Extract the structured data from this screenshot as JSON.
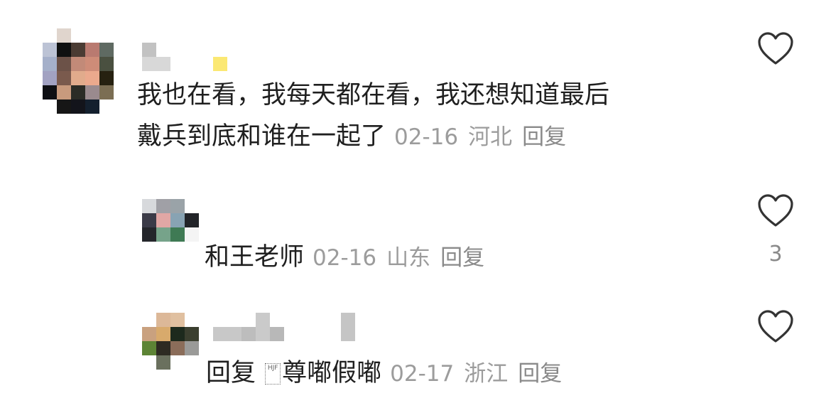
{
  "comments": [
    {
      "text_line1": "我也在看，我每天都在看，我还想知道最后",
      "text_line2": "戴兵到底和谁在一起了",
      "date": "02-16",
      "location": "河北",
      "reply_label": "回复",
      "like_icon": "heart-outline-icon",
      "like_count": ""
    },
    {
      "text": "和王老师",
      "date": "02-16",
      "location": "山东",
      "reply_label": "回复",
      "like_icon": "heart-outline-icon",
      "like_count": "3"
    },
    {
      "text_prefix": "回复",
      "text_glyph": "HJF",
      "text_main": "尊嘟假嘟",
      "date": "02-17",
      "location": "浙江",
      "reply_label": "回复",
      "like_icon": "heart-outline-icon",
      "like_count": ""
    }
  ],
  "colors": {
    "text_primary": "#1f1f1f",
    "text_meta": "#9c9c9c",
    "heart_stroke": "#333333"
  }
}
